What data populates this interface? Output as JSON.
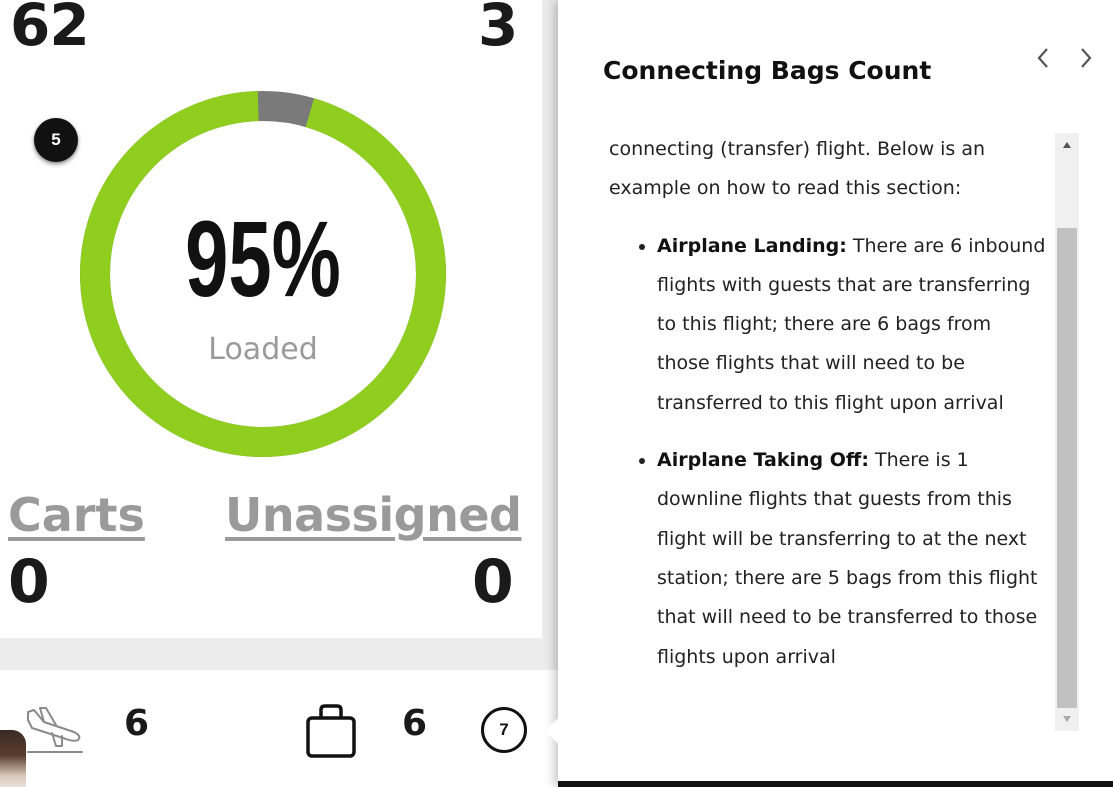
{
  "stats": {
    "top_left_value": "62",
    "top_right_value": "3",
    "percent_label": "95%",
    "percent_value": 0.95,
    "loaded_label": "Loaded",
    "carts_label": "Carts",
    "carts_value": "0",
    "unassigned_label": "Unassigned",
    "unassigned_value": "0",
    "ring_colors": {
      "loaded": "#8fce1e",
      "remaining": "#7a7a7a"
    }
  },
  "steps": {
    "step_5": "5",
    "step_7": "7"
  },
  "bottom_bar": {
    "inbound_icon": "plane-landing-icon",
    "inbound_count": "6",
    "bag_icon": "bag-icon",
    "bag_count": "6"
  },
  "help_panel": {
    "title": "Connecting Bags Count",
    "intro": "connecting (transfer) flight. Below is an example on how to read this section:",
    "items": [
      {
        "heading": "Airplane Landing:",
        "text": " There are 6 inbound flights with guests that are transferring to this flight; there are 6 bags from those flights that will need to be transferred to this flight upon arrival"
      },
      {
        "heading": "Airplane Taking Off:",
        "text": " There is 1 downline flights that guests from this flight will be transferring to at the next station; there are 5 bags from this flight that will need to be transferred to those flights upon arrival"
      }
    ],
    "scroll_position": 0.2
  }
}
